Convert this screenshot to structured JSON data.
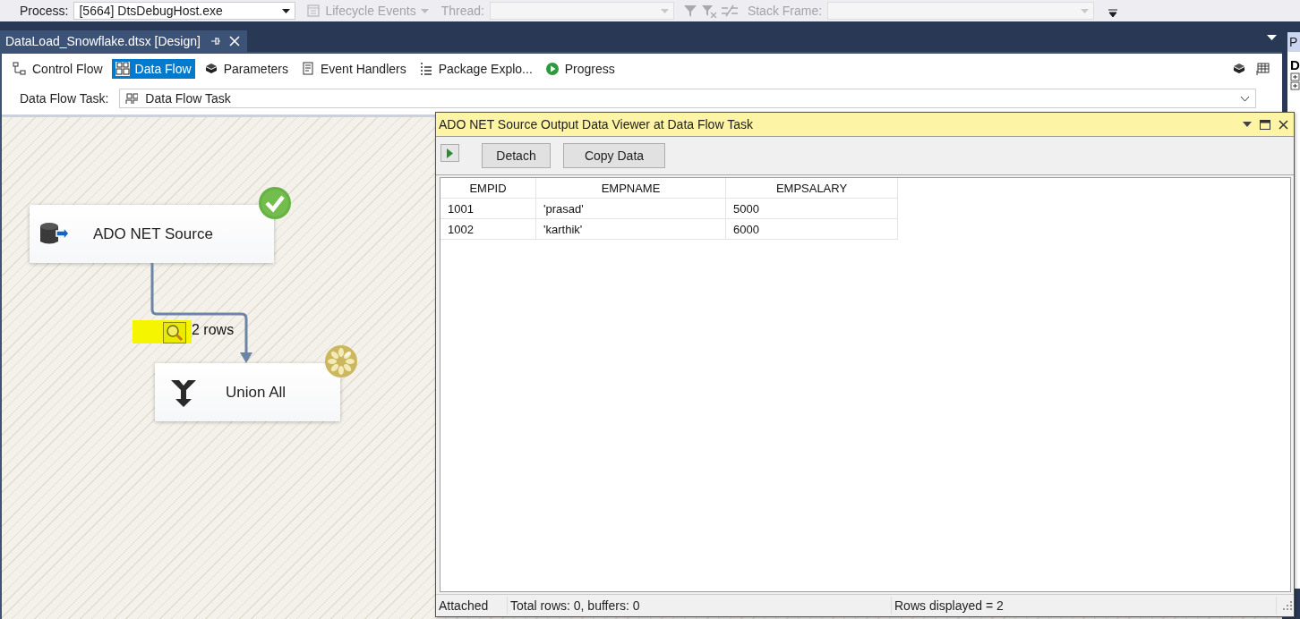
{
  "toolbar": {
    "items": [
      {
        "kind": "label",
        "text": "Process:",
        "disabled": false
      },
      {
        "kind": "combo",
        "value": "[5664] DtsDebugHost.exe",
        "disabled": false
      },
      {
        "kind": "dropdown-button",
        "text": "Lifecycle Events",
        "disabled": true
      },
      {
        "kind": "label",
        "text": "Thread:",
        "disabled": true
      },
      {
        "kind": "combo",
        "disabled": true
      },
      {
        "kind": "filter-icons",
        "disabled": true
      },
      {
        "kind": "label",
        "text": "Stack Frame:",
        "disabled": true
      },
      {
        "kind": "combo",
        "disabled": true
      }
    ]
  },
  "document_tab": {
    "title": "DataLoad_Snowflake.dtsx [Design]",
    "selected": true
  },
  "designer_tabs": [
    {
      "kind": "control-flow",
      "label": "Control Flow",
      "selected": false
    },
    {
      "kind": "data-flow",
      "label": "Data Flow",
      "selected": true
    },
    {
      "kind": "parameters",
      "label": "Parameters",
      "selected": false
    },
    {
      "kind": "event-handlers",
      "label": "Event Handlers",
      "selected": false
    },
    {
      "kind": "package-explorer",
      "label": "Package Explo...",
      "selected": false
    },
    {
      "kind": "progress",
      "label": "Progress",
      "selected": false
    }
  ],
  "data_flow_task": {
    "label": "Data Flow Task:",
    "value": "Data Flow Task"
  },
  "canvas": {
    "nodes": [
      {
        "kind": "source",
        "label": "ADO NET Source",
        "succeeded": true
      },
      {
        "kind": "union",
        "label": "Union All",
        "succeeded": false
      }
    ],
    "path": {
      "label": "2 rows",
      "data_viewer": true
    }
  },
  "data_viewer": {
    "title": "ADO NET Source Output Data Viewer at Data Flow Task",
    "buttons": [
      "Detach",
      "Copy Data"
    ],
    "columns": [
      "EMPID",
      "EMPNAME",
      "EMPSALARY"
    ],
    "rows": [
      [
        "1001",
        "'prasad'",
        "5000"
      ],
      [
        "1002",
        "'karthik'",
        "6000"
      ]
    ],
    "status_bar": [
      "Attached",
      "Total rows: 0, buffers: 0",
      "Rows displayed = 2"
    ]
  },
  "side_panel": {
    "title": "P",
    "item": "D"
  }
}
